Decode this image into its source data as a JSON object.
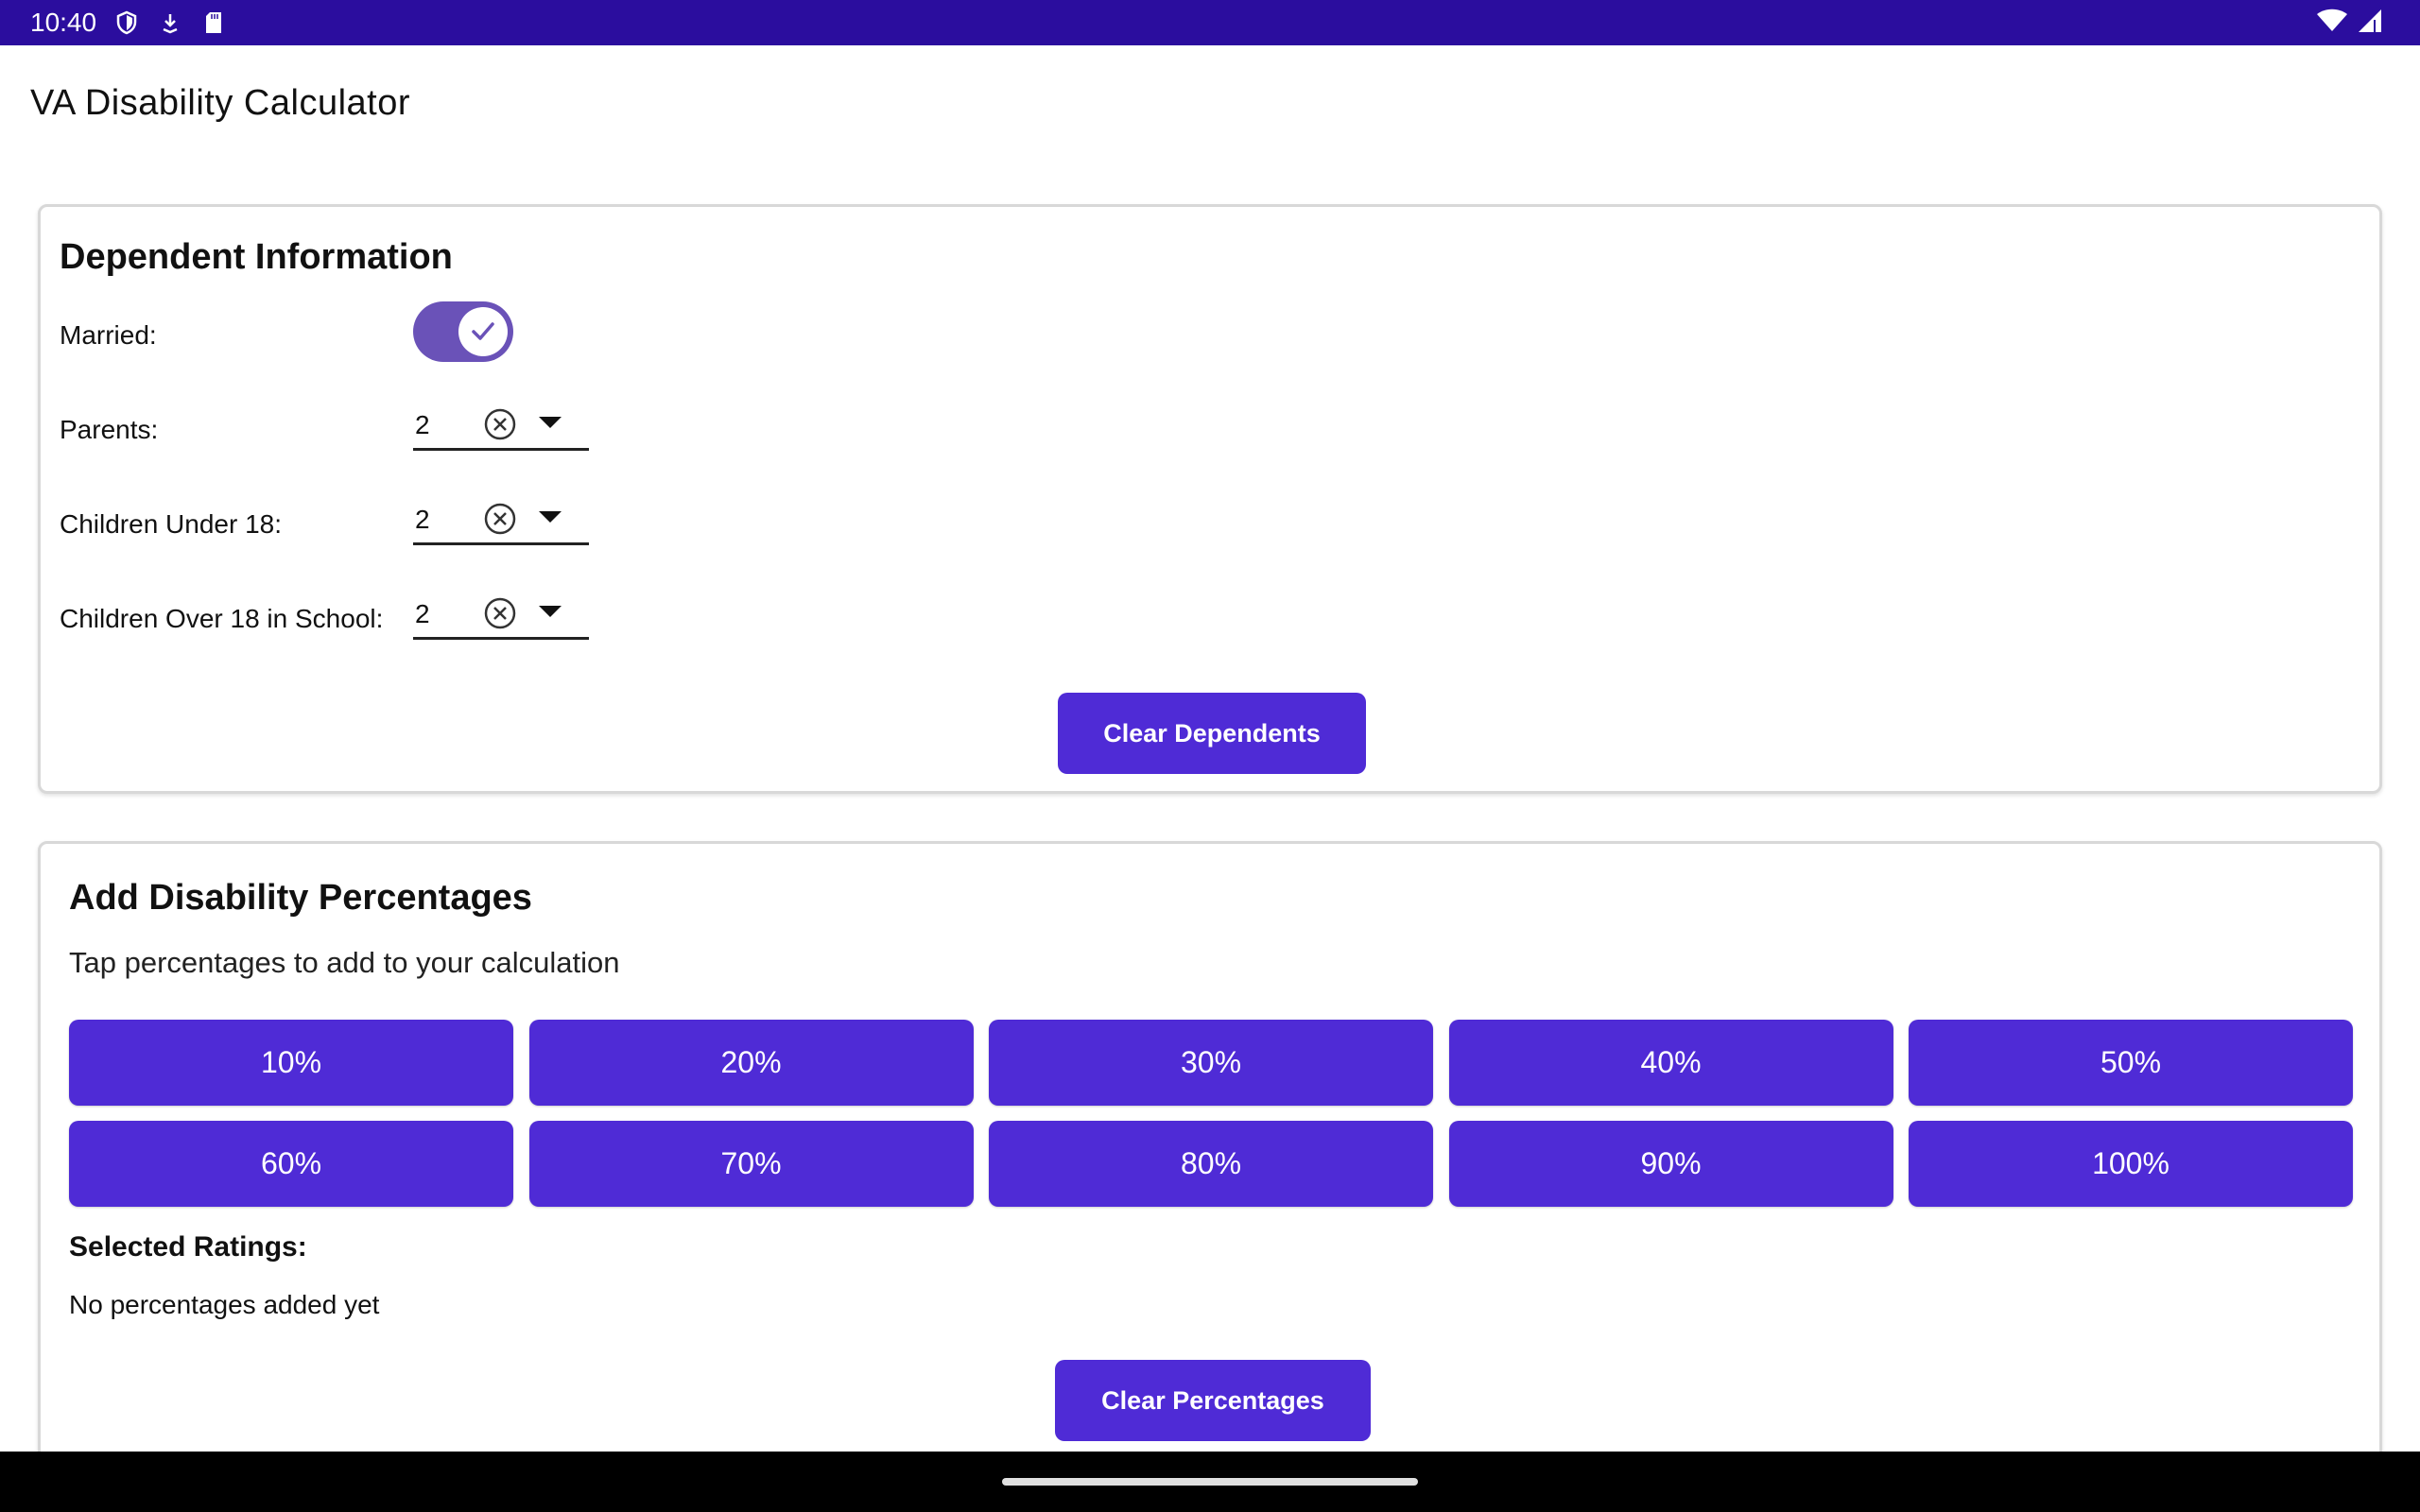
{
  "status_bar": {
    "time": "10:40",
    "icons_left": [
      "shield-icon",
      "download-icon",
      "sd-card-icon"
    ],
    "icons_right": [
      "wifi-icon",
      "signal-icon"
    ],
    "background": "#2b0d9e"
  },
  "app": {
    "title": "VA Disability Calculator"
  },
  "dependents": {
    "heading": "Dependent Information",
    "married_label": "Married:",
    "married_on": true,
    "fields": [
      {
        "label": "Parents:",
        "value": "2"
      },
      {
        "label": "Children Under 18:",
        "value": "2"
      },
      {
        "label": "Children Over 18 in School:",
        "value": "2"
      }
    ],
    "clear_label": "Clear Dependents"
  },
  "percentages": {
    "heading": "Add Disability Percentages",
    "subtitle": "Tap percentages to add to your calculation",
    "options": [
      "10%",
      "20%",
      "30%",
      "40%",
      "50%",
      "60%",
      "70%",
      "80%",
      "90%",
      "100%"
    ],
    "selected_label": "Selected Ratings:",
    "empty_text": "No percentages added yet",
    "clear_label": "Clear Percentages"
  },
  "colors": {
    "accent": "#4f2bd6",
    "toggle": "#6a52b8"
  }
}
